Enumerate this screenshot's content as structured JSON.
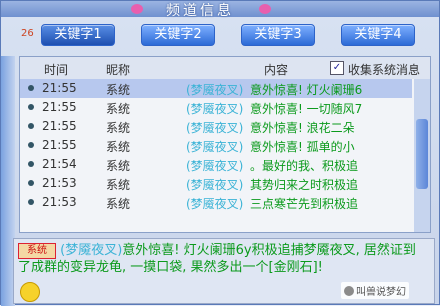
{
  "window": {
    "title": "频道信息"
  },
  "tabs": {
    "count": "26",
    "items": [
      {
        "label": "关键字1"
      },
      {
        "label": "关键字2"
      },
      {
        "label": "关键字3"
      },
      {
        "label": "关键字4"
      }
    ]
  },
  "table": {
    "columns": {
      "time": "时间",
      "nick": "昵称",
      "content": "内容"
    },
    "collect_label": "收集系统消息",
    "collect_checked": true,
    "rows": [
      {
        "time": "21:55",
        "nick": "系统",
        "user": "(梦魇夜叉)",
        "msg": "意外惊喜! 灯火阑珊6"
      },
      {
        "time": "21:55",
        "nick": "系统",
        "user": "(梦魇夜叉)",
        "msg": "意外惊喜! 一切随风7"
      },
      {
        "time": "21:55",
        "nick": "系统",
        "user": "(梦魇夜叉)",
        "msg": "意外惊喜! 浪花二朵"
      },
      {
        "time": "21:55",
        "nick": "系统",
        "user": "(梦魇夜叉)",
        "msg": "意外惊喜! 孤单的小"
      },
      {
        "time": "21:54",
        "nick": "系统",
        "user": "(梦魇夜叉)",
        "msg": "。最好的我、积极追"
      },
      {
        "time": "21:53",
        "nick": "系统",
        "user": "(梦魇夜叉)",
        "msg": "其势归来之时积极追"
      },
      {
        "time": "21:53",
        "nick": "系统",
        "user": "(梦魇夜叉)",
        "msg": "三点寒芒先到积极追"
      }
    ]
  },
  "detail": {
    "badge": "系统",
    "user": "(梦魇夜叉)",
    "msg": "意外惊喜! 灯火阑珊6y积极追捕梦魇夜叉, 居然证到了成群的变异龙龟, 一摸口袋, 果然多出一个",
    "item": "[金刚石]!"
  },
  "watermark": "叫兽说梦幻"
}
